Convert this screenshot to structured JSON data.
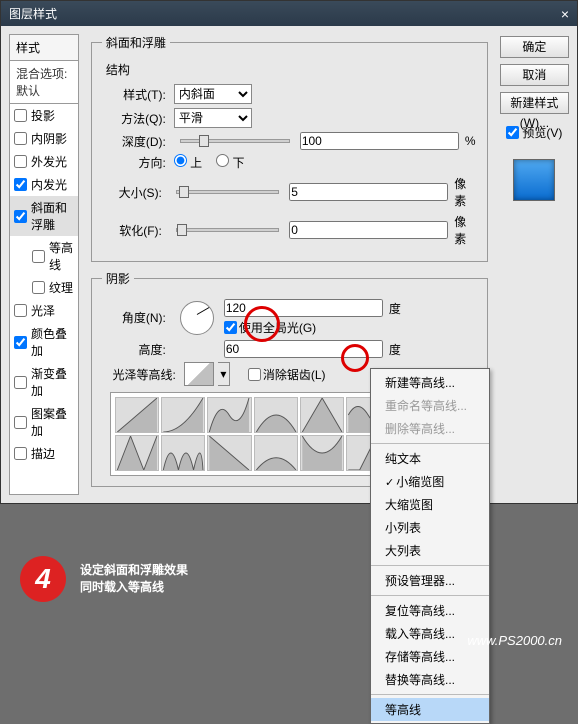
{
  "title": "图层样式",
  "sidebar": {
    "header": "样式",
    "blend": "混合选项:默认",
    "items": [
      {
        "label": "投影",
        "checked": false,
        "indent": false
      },
      {
        "label": "内阴影",
        "checked": false,
        "indent": false
      },
      {
        "label": "外发光",
        "checked": false,
        "indent": false
      },
      {
        "label": "内发光",
        "checked": true,
        "indent": false
      },
      {
        "label": "斜面和浮雕",
        "checked": true,
        "indent": false,
        "sel": true
      },
      {
        "label": "等高线",
        "checked": false,
        "indent": true
      },
      {
        "label": "纹理",
        "checked": false,
        "indent": true
      },
      {
        "label": "光泽",
        "checked": false,
        "indent": false
      },
      {
        "label": "颜色叠加",
        "checked": true,
        "indent": false
      },
      {
        "label": "渐变叠加",
        "checked": false,
        "indent": false
      },
      {
        "label": "图案叠加",
        "checked": false,
        "indent": false
      },
      {
        "label": "描边",
        "checked": false,
        "indent": false
      }
    ]
  },
  "bevel": {
    "group_title": "斜面和浮雕",
    "structure": "结构",
    "style_label": "样式(T):",
    "style_value": "内斜面",
    "tech_label": "方法(Q):",
    "tech_value": "平滑",
    "depth_label": "深度(D):",
    "depth_value": "100",
    "depth_unit": "%",
    "dir_label": "方向:",
    "dir_up": "上",
    "dir_down": "下",
    "size_label": "大小(S):",
    "size_value": "5",
    "size_unit": "像素",
    "soft_label": "软化(F):",
    "soft_value": "0",
    "soft_unit": "像素"
  },
  "shading": {
    "group": "阴影",
    "angle_label": "角度(N):",
    "angle_value": "120",
    "angle_unit": "度",
    "global": "使用全局光(G)",
    "alt_label": "高度:",
    "alt_value": "60",
    "alt_unit": "度",
    "gloss_label": "光泽等高线:",
    "aa": "消除锯齿(L)"
  },
  "buttons": {
    "ok": "确定",
    "cancel": "取消",
    "new": "新建样式(W)...",
    "preview": "预览(V)"
  },
  "ctx": {
    "new": "新建等高线...",
    "rename": "重命名等高线...",
    "delete": "删除等高线...",
    "text": "纯文本",
    "small": "小缩览图",
    "large": "大缩览图",
    "slist": "小列表",
    "llist": "大列表",
    "preset": "预设管理器...",
    "reset": "复位等高线...",
    "load": "载入等高线...",
    "save": "存储等高线...",
    "replace": "替换等高线...",
    "contours": "等高线"
  },
  "step": {
    "num": "4",
    "line1": "设定斜面和浮雕效果",
    "line2": "同时载入等高线"
  },
  "watermark": "www.PS2000.cn"
}
